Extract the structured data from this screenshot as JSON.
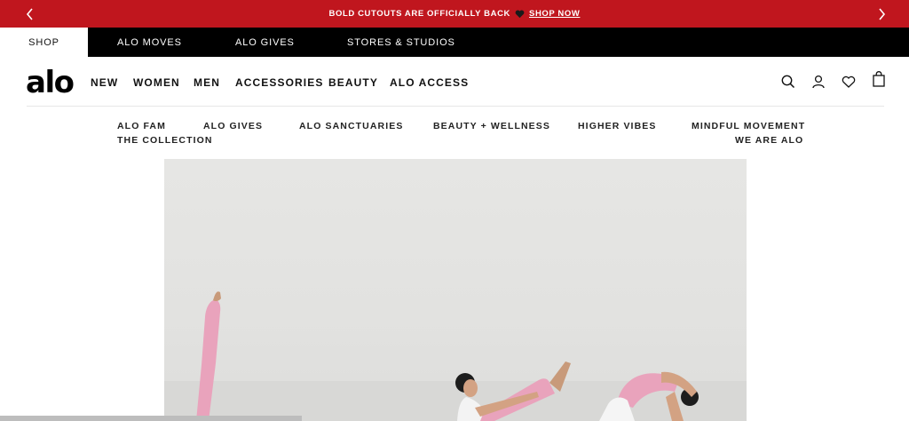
{
  "announcement": {
    "message": "BOLD CUTOUTS ARE OFFICIALLY BACK",
    "link": "SHOP NOW",
    "prev_icon": "chevron-left-icon",
    "next_icon": "chevron-right-icon",
    "heart_icon": "heart-icon"
  },
  "utility_tabs": [
    {
      "label": "SHOP",
      "active": true
    },
    {
      "label": "ALO MOVES"
    },
    {
      "label": "ALO GIVES"
    },
    {
      "label": "STORES & STUDIOS"
    }
  ],
  "logo": "alo",
  "main_nav": [
    "NEW",
    "WOMEN",
    "MEN",
    "ACCESSORIES",
    "BEAUTY",
    "ALO ACCESS"
  ],
  "header_icons": [
    "search-icon",
    "account-icon",
    "wishlist-heart-icon",
    "bag-icon"
  ],
  "sub_nav": [
    "ALO FAM",
    "ALO GIVES",
    "ALO SANCTUARIES",
    "BEAUTY + WELLNESS",
    "HIGHER VIBES",
    "MINDFUL MOVEMENT",
    "THE COLLECTION",
    "WE ARE ALO"
  ],
  "colors": {
    "announcement_bg": "#c0161e",
    "utility_bg": "#000000",
    "text": "#111111",
    "hero_bg": "#e4e4e2",
    "legging_pink": "#e9a3bc"
  }
}
